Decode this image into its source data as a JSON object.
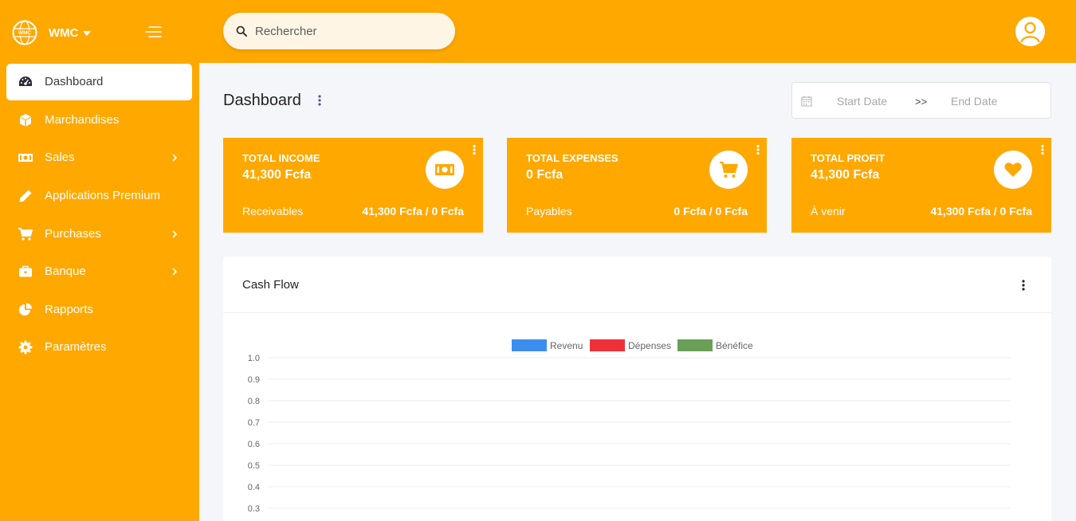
{
  "brand": {
    "name": "WMC",
    "logo_text": "WMC"
  },
  "sidebar": {
    "items": [
      {
        "label": "Dashboard",
        "icon": "gauge-icon",
        "active": true,
        "has_submenu": false
      },
      {
        "label": "Marchandises",
        "icon": "box-icon",
        "active": false,
        "has_submenu": false
      },
      {
        "label": "Sales",
        "icon": "money-bill-icon",
        "active": false,
        "has_submenu": true
      },
      {
        "label": "Applications Premium",
        "icon": "pencil-icon",
        "active": false,
        "has_submenu": false
      },
      {
        "label": "Purchases",
        "icon": "cart-icon",
        "active": false,
        "has_submenu": true
      },
      {
        "label": "Banque",
        "icon": "briefcase-icon",
        "active": false,
        "has_submenu": true
      },
      {
        "label": "Rapports",
        "icon": "pie-chart-icon",
        "active": false,
        "has_submenu": false
      },
      {
        "label": "Paramètres",
        "icon": "gear-icon",
        "active": false,
        "has_submenu": false
      }
    ]
  },
  "search": {
    "placeholder": "Rechercher",
    "value": ""
  },
  "page": {
    "title": "Dashboard"
  },
  "daterange": {
    "start_placeholder": "Start Date",
    "separator": ">>",
    "end_placeholder": "End Date"
  },
  "cards": [
    {
      "title": "TOTAL INCOME",
      "amount": "41,300 Fcfa",
      "sub_label": "Receivables",
      "sub_value": "41,300 Fcfa / 0 Fcfa",
      "icon": "money-bill-icon"
    },
    {
      "title": "TOTAL EXPENSES",
      "amount": "0 Fcfa",
      "sub_label": "Payables",
      "sub_value": "0 Fcfa / 0 Fcfa",
      "icon": "cart-icon"
    },
    {
      "title": "TOTAL PROFIT",
      "amount": "41,300 Fcfa",
      "sub_label": "À venir",
      "sub_value": "41,300 Fcfa / 0 Fcfa",
      "icon": "heart-icon"
    }
  ],
  "colors": {
    "accent": "#FFA800",
    "revenu": "#3C8DEE",
    "depenses": "#EE3138",
    "benefice": "#6A9F58"
  },
  "cashflow": {
    "title": "Cash Flow",
    "chart_data": {
      "type": "bar",
      "title": "",
      "xlabel": "",
      "ylabel": "",
      "ylim": [
        0,
        1.0
      ],
      "yticks": [
        "1.0",
        "0.9",
        "0.8",
        "0.7",
        "0.6",
        "0.5",
        "0.4",
        "0.3"
      ],
      "grid": true,
      "legend": "top-center",
      "categories": [],
      "series": [
        {
          "name": "Revenu",
          "values": [],
          "color": "#3C8DEE"
        },
        {
          "name": "Dépenses",
          "values": [],
          "color": "#EE3138"
        },
        {
          "name": "Bénéfice",
          "values": [],
          "color": "#6A9F58"
        }
      ]
    }
  }
}
